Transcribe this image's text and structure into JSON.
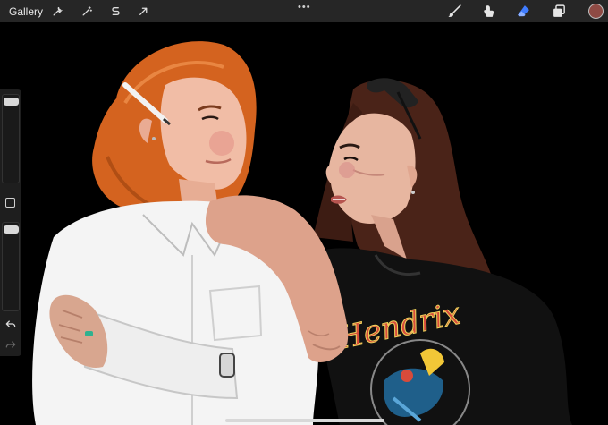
{
  "topbar": {
    "gallery_label": "Gallery",
    "left_tools": [
      "wrench-icon",
      "magic-wand-icon",
      "selection-s-icon",
      "transform-arrow-icon"
    ],
    "center_menu": "•••",
    "right_tools": [
      "brush-icon",
      "smudge-icon",
      "eraser-icon",
      "layers-icon"
    ],
    "active_tool": "eraser-icon",
    "current_color": "#8e4a44",
    "eraser_color": "#3f7cff"
  },
  "sidebar": {
    "brush_size_level": 0.95,
    "opacity_level": 0.95,
    "tools": [
      "modify-square-icon",
      "undo-icon",
      "redo-icon"
    ]
  },
  "canvas": {
    "background": "#000000",
    "artwork_text": "Hendrix"
  }
}
